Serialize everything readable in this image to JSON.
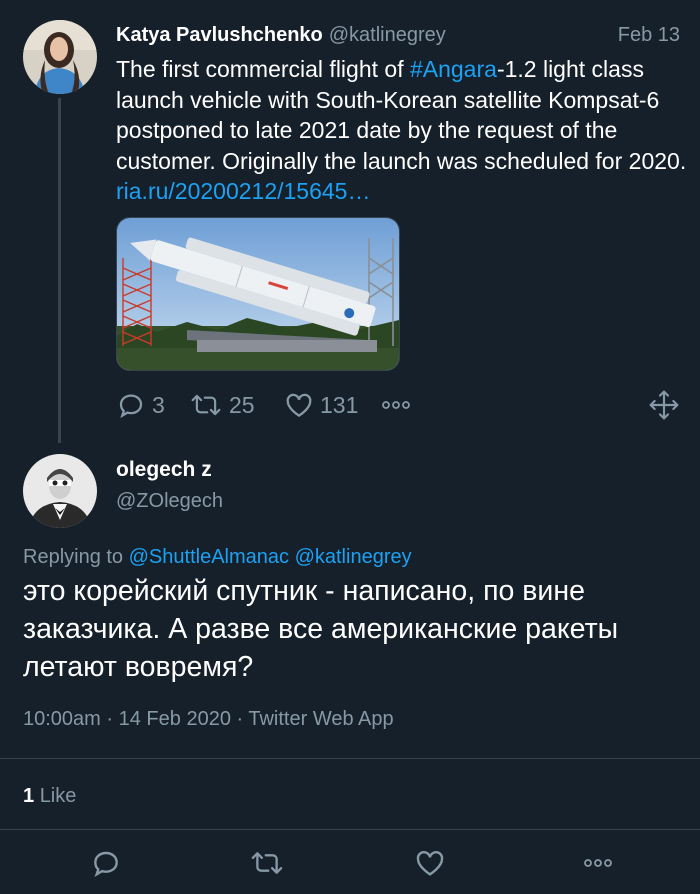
{
  "parent_tweet": {
    "author_name": "Katya Pavlushchenko",
    "author_handle": "@katlinegrey",
    "date": "Feb 13",
    "text_before_hashtag": "The first commercial flight of ",
    "hashtag": "#Angara",
    "text_after_hashtag": "-1.2 light class launch vehicle with South-Korean satellite Kompsat-6 postponed to late 2021 date by the request of the customer. Originally the launch was scheduled for 2020. ",
    "link": "ria.ru/20200212/15645…",
    "media_alt": "Angara rocket on launch pad",
    "actions": {
      "replies": "3",
      "retweets": "25",
      "likes": "131"
    }
  },
  "reply_tweet": {
    "author_name": "olegech z",
    "author_handle": "@ZOlegech",
    "replying_label": "Replying to",
    "mentions": [
      "@ShuttleAlmanac",
      "@katlinegrey"
    ],
    "text": "это корейский спутник - написано, по вине заказчика. А разве все американские ракеты летают вовремя?",
    "time": "10:00am",
    "date": "14 Feb 2020",
    "source": "Twitter Web App",
    "like_count": "1",
    "like_label": "Like"
  },
  "colors": {
    "background": "#15202b",
    "muted": "#8899a6",
    "accent": "#1da1f2",
    "divider": "#38444d"
  },
  "icons": [
    "reply-icon",
    "retweet-icon",
    "like-icon",
    "more-icon",
    "move-icon"
  ]
}
